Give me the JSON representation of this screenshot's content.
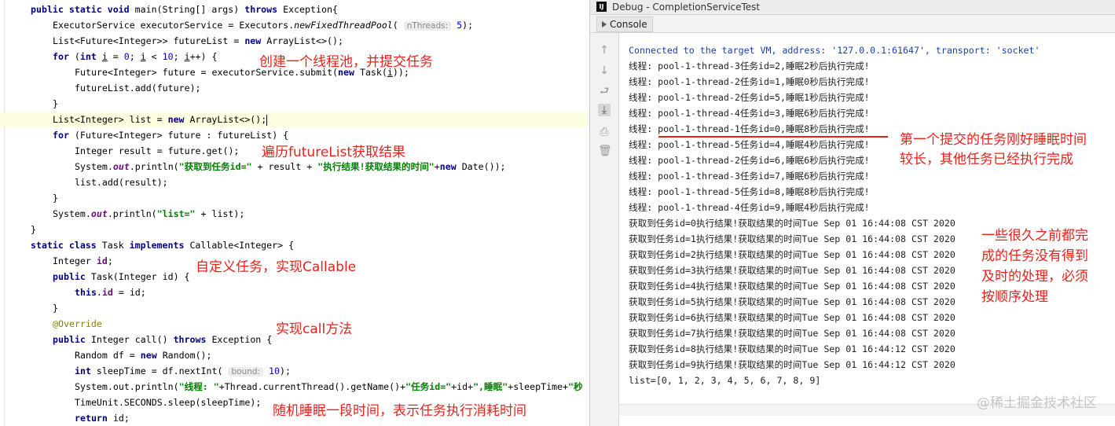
{
  "editor": {
    "lines": [
      [
        [
          "kw",
          "public static void "
        ],
        [
          "",
          "main(String[] args) "
        ],
        [
          "kw",
          "throws "
        ],
        [
          "",
          "Exception{"
        ]
      ],
      [
        [
          "",
          "ExecutorService executorService = Executors."
        ],
        [
          "italic",
          "newFixedThreadPool"
        ],
        [
          "",
          "( "
        ],
        [
          "hint",
          "nThreads:"
        ],
        [
          "num",
          " 5"
        ],
        [
          "",
          "); "
        ]
      ],
      [
        [
          "",
          "List<Future<Integer>> futureList = "
        ],
        [
          "kw",
          "new "
        ],
        [
          "",
          "ArrayList<>();"
        ]
      ],
      [
        [
          "kw",
          "for "
        ],
        [
          "",
          "("
        ],
        [
          "kw",
          "int "
        ],
        [
          "underline",
          "i"
        ],
        [
          "",
          " = "
        ],
        [
          "num",
          "0"
        ],
        [
          "",
          "; "
        ],
        [
          "underline",
          "i"
        ],
        [
          "",
          " < "
        ],
        [
          "num",
          "10"
        ],
        [
          "",
          "; "
        ],
        [
          "underline",
          "i"
        ],
        [
          "",
          "++) {"
        ]
      ],
      [
        [
          "",
          "Future<Integer> future = executorService.submit("
        ],
        [
          "kw",
          "new "
        ],
        [
          "",
          "Task("
        ],
        [
          "underline",
          "i"
        ],
        [
          "",
          "));"
        ]
      ],
      [
        [
          "",
          "futureList.add(future);"
        ]
      ],
      [
        [
          "",
          "}"
        ]
      ],
      [
        [
          "",
          "List<Integer> list = "
        ],
        [
          "kw",
          "new "
        ],
        [
          "",
          "ArrayList<>();"
        ],
        [
          "caret",
          ""
        ]
      ],
      [
        [
          "kw",
          "for "
        ],
        [
          "",
          "(Future<Integer> future : futureList) {"
        ]
      ],
      [
        [
          "",
          "Integer result = future.get();"
        ]
      ],
      [
        [
          "",
          "System."
        ],
        [
          "static-it",
          "out"
        ],
        [
          "",
          ".println("
        ],
        [
          "str",
          "\"获取到任务id=\""
        ],
        [
          "",
          " + result + "
        ],
        [
          "str",
          "\"执行结果!获取结果的时间\""
        ],
        [
          "",
          "+"
        ],
        [
          "kw",
          "new "
        ],
        [
          "",
          "Date());"
        ]
      ],
      [
        [
          "",
          "list.add(result);"
        ]
      ],
      [
        [
          "",
          "}"
        ]
      ],
      [
        [
          "",
          "System."
        ],
        [
          "static-it",
          "out"
        ],
        [
          "",
          ".println("
        ],
        [
          "str",
          "\"list=\""
        ],
        [
          "",
          " + list);"
        ]
      ],
      [
        [
          "",
          "}"
        ]
      ],
      [
        [
          "kw",
          "static class "
        ],
        [
          "",
          "Task "
        ],
        [
          "kw",
          "implements "
        ],
        [
          "",
          "Callable<Integer> {"
        ]
      ],
      [
        [
          "",
          "Integer "
        ],
        [
          "field",
          "id"
        ],
        [
          "",
          ";"
        ]
      ],
      [
        [
          "kw",
          "public "
        ],
        [
          "",
          "Task(Integer id) {"
        ]
      ],
      [
        [
          "kw",
          "this"
        ],
        [
          "",
          "."
        ],
        [
          "field",
          "id"
        ],
        [
          "",
          " = id;"
        ]
      ],
      [
        [
          "",
          "}"
        ]
      ],
      [
        [
          "anno",
          "@Override"
        ]
      ],
      [
        [
          "kw",
          "public "
        ],
        [
          "",
          "Integer call() "
        ],
        [
          "kw",
          "throws "
        ],
        [
          "",
          "Exception {"
        ]
      ],
      [
        [
          "",
          "Random df = "
        ],
        [
          "kw",
          "new "
        ],
        [
          "",
          "Random();"
        ]
      ],
      [
        [
          "kw",
          "int "
        ],
        [
          "",
          "sleepTime = df.nextInt( "
        ],
        [
          "hint",
          "bound:"
        ],
        [
          "num",
          " 10"
        ],
        [
          "",
          ");"
        ]
      ],
      [
        [
          "",
          "System.out.println("
        ],
        [
          "str",
          "\"线程: \""
        ],
        [
          "",
          "+Thread.currentThread().getName()+"
        ],
        [
          "str",
          "\"任务id=\""
        ],
        [
          "",
          "+id+"
        ],
        [
          "str",
          "\",睡眠\""
        ],
        [
          "",
          "+sleepTime+"
        ],
        [
          "str",
          "\"秒"
        ]
      ],
      [
        [
          "",
          "TimeUnit.SECONDS.sleep(sleepTime);"
        ]
      ],
      [
        [
          "kw",
          "return "
        ],
        [
          "",
          "id;"
        ]
      ]
    ],
    "annotations": {
      "create_pool": "创建一个线程池，并提交任务",
      "iterate": "遍历futureList获取结果",
      "custom_task": "自定义任务，实现Callable",
      "call_method": "实现call方法",
      "random_sleep": "随机睡眠一段时间，表示任务执行消耗时间"
    }
  },
  "debug": {
    "window_title": "Debug - CompletionServiceTest",
    "logo": "IJ",
    "tab_label": "Console",
    "toolbar_icons": [
      "up-arrow-icon",
      "down-arrow-icon",
      "soft-wrap-icon",
      "scroll-to-end-icon",
      "print-icon",
      "trash-icon"
    ],
    "console_lines": [
      "Connected to the target VM, address: '127.0.0.1:61647', transport: 'socket'",
      "线程: pool-1-thread-3任务id=2,睡眠2秒后执行完成!",
      "线程: pool-1-thread-2任务id=1,睡眠0秒后执行完成!",
      "线程: pool-1-thread-2任务id=5,睡眠1秒后执行完成!",
      "线程: pool-1-thread-4任务id=3,睡眠6秒后执行完成!",
      "线程: pool-1-thread-1任务id=0,睡眠8秒后执行完成!",
      "线程: pool-1-thread-5任务id=4,睡眠4秒后执行完成!",
      "线程: pool-1-thread-2任务id=6,睡眠6秒后执行完成!",
      "线程: pool-1-thread-3任务id=7,睡眠6秒后执行完成!",
      "线程: pool-1-thread-5任务id=8,睡眠8秒后执行完成!",
      "线程: pool-1-thread-4任务id=9,睡眠4秒后执行完成!",
      "获取到任务id=0执行结果!获取结果的时间Tue Sep 01 16:44:08 CST 2020",
      "获取到任务id=1执行结果!获取结果的时间Tue Sep 01 16:44:08 CST 2020",
      "获取到任务id=2执行结果!获取结果的时间Tue Sep 01 16:44:08 CST 2020",
      "获取到任务id=3执行结果!获取结果的时间Tue Sep 01 16:44:08 CST 2020",
      "获取到任务id=4执行结果!获取结果的时间Tue Sep 01 16:44:08 CST 2020",
      "获取到任务id=5执行结果!获取结果的时间Tue Sep 01 16:44:08 CST 2020",
      "获取到任务id=6执行结果!获取结果的时间Tue Sep 01 16:44:08 CST 2020",
      "获取到任务id=7执行结果!获取结果的时间Tue Sep 01 16:44:08 CST 2020",
      "获取到任务id=8执行结果!获取结果的时间Tue Sep 01 16:44:12 CST 2020",
      "获取到任务id=9执行结果!获取结果的时间Tue Sep 01 16:44:12 CST 2020",
      "list=[0, 1, 2, 3, 4, 5, 6, 7, 8, 9]"
    ],
    "notes": {
      "first_task_1": "第一个提交的任务刚好睡眠时间",
      "first_task_2": "较长，其他任务已经执行完成",
      "old_tasks_1": "一些很久之前都完",
      "old_tasks_2": "成的任务没有得到",
      "old_tasks_3": "及时的处理，必须",
      "old_tasks_4": "按顺序处理"
    },
    "watermark": "@稀土掘金技术社区"
  },
  "colors": {
    "annotation_red": "#e8221b",
    "keyword": "#000080",
    "string": "#008000",
    "console_blue": "#1b3fa8"
  }
}
